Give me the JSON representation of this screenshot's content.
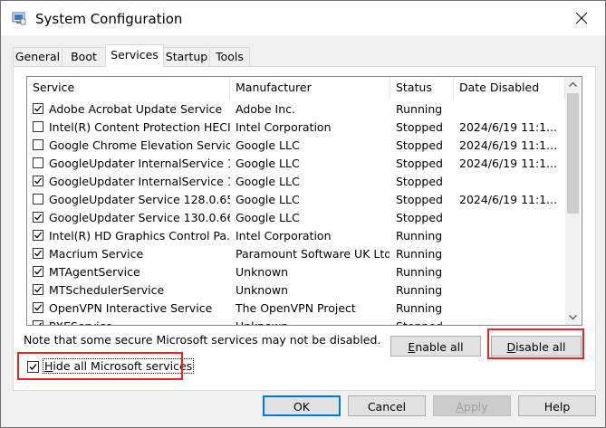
{
  "window": {
    "title": "System Configuration"
  },
  "tabs": [
    {
      "label": "General"
    },
    {
      "label": "Boot"
    },
    {
      "label": "Services",
      "active": true
    },
    {
      "label": "Startup"
    },
    {
      "label": "Tools"
    }
  ],
  "table": {
    "headers": {
      "service": "Service",
      "manufacturer": "Manufacturer",
      "status": "Status",
      "date_disabled": "Date Disabled"
    },
    "rows": [
      {
        "checked": true,
        "service": "Adobe Acrobat Update Service",
        "manufacturer": "Adobe Inc.",
        "status": "Running",
        "date": ""
      },
      {
        "checked": false,
        "service": "Intel(R) Content Protection HECI...",
        "manufacturer": "Intel Corporation",
        "status": "Stopped",
        "date": "2024/6/19 11:1..."
      },
      {
        "checked": false,
        "service": "Google Chrome Elevation Servic...",
        "manufacturer": "Google LLC",
        "status": "Stopped",
        "date": "2024/6/19 11:1..."
      },
      {
        "checked": false,
        "service": "GoogleUpdater InternalService 1...",
        "manufacturer": "Google LLC",
        "status": "Stopped",
        "date": "2024/6/19 11:1..."
      },
      {
        "checked": true,
        "service": "GoogleUpdater InternalService 1...",
        "manufacturer": "Google LLC",
        "status": "Stopped",
        "date": ""
      },
      {
        "checked": false,
        "service": "GoogleUpdater Service 128.0.65...",
        "manufacturer": "Google LLC",
        "status": "Stopped",
        "date": "2024/6/19 11:1..."
      },
      {
        "checked": true,
        "service": "GoogleUpdater Service 130.0.66...",
        "manufacturer": "Google LLC",
        "status": "Stopped",
        "date": ""
      },
      {
        "checked": true,
        "service": "Intel(R) HD Graphics Control Pa...",
        "manufacturer": "Intel Corporation",
        "status": "Running",
        "date": ""
      },
      {
        "checked": true,
        "service": "Macrium Service",
        "manufacturer": "Paramount Software UK Ltd",
        "status": "Running",
        "date": ""
      },
      {
        "checked": true,
        "service": "MTAgentService",
        "manufacturer": "Unknown",
        "status": "Running",
        "date": ""
      },
      {
        "checked": true,
        "service": "MTSchedulerService",
        "manufacturer": "Unknown",
        "status": "Running",
        "date": ""
      },
      {
        "checked": true,
        "service": "OpenVPN Interactive Service",
        "manufacturer": "The OpenVPN Project",
        "status": "Running",
        "date": ""
      },
      {
        "checked": true,
        "service": "PXEService",
        "manufacturer": "Unknown",
        "status": "Stopped",
        "date": ""
      }
    ]
  },
  "note": "Note that some secure Microsoft services may not be disabled.",
  "buttons": {
    "enable_all": {
      "pre": "",
      "key": "E",
      "post": "nable all"
    },
    "disable_all": {
      "pre": "",
      "key": "D",
      "post": "isable all"
    },
    "ok": "OK",
    "cancel": "Cancel",
    "apply": {
      "pre": "",
      "key": "A",
      "post": "pply"
    },
    "help": "Help"
  },
  "hide_ms": {
    "checked": true,
    "pre": "",
    "key": "H",
    "post": "ide all Microsoft services"
  },
  "colors": {
    "highlight_box": "#e8231b",
    "default_button_border": "#0078d7"
  }
}
